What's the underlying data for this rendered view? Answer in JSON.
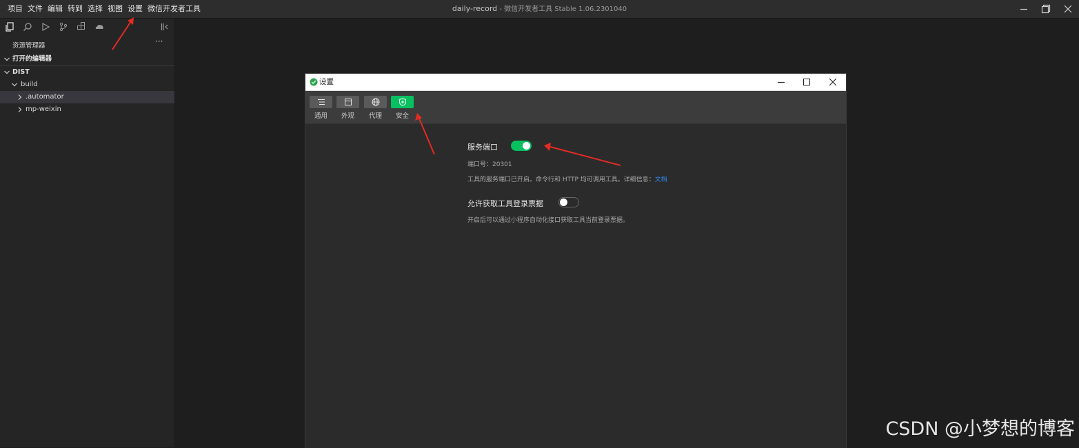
{
  "menu": {
    "items": [
      "项目",
      "文件",
      "编辑",
      "转到",
      "选择",
      "视图",
      "设置",
      "微信开发者工具"
    ]
  },
  "window": {
    "project": "daily-record",
    "separator": " - ",
    "app_name": "微信开发者工具 Stable 1.06.2301040"
  },
  "sidebar": {
    "toolbar_icons": [
      "files-icon",
      "search-icon",
      "debug-icon",
      "source-control-icon",
      "extensions-icon",
      "cloud-icon"
    ],
    "explorer_title": "资源管理器",
    "more": "···",
    "open_editors": "打开的编辑器",
    "tree": {
      "root": "DIST",
      "build": "build",
      "automator": ".automator",
      "mp_weixin": "mp-weixin"
    }
  },
  "dialog": {
    "title": "设置",
    "tabs": [
      {
        "label": "通用",
        "icon": "list-icon",
        "active": false
      },
      {
        "label": "外观",
        "icon": "window-icon",
        "active": false
      },
      {
        "label": "代理",
        "icon": "globe-icon",
        "active": false
      },
      {
        "label": "安全",
        "icon": "shield-icon",
        "active": true
      }
    ],
    "service_port": {
      "title": "服务端口",
      "enabled": true,
      "port_line": "端口号：20301",
      "desc": "工具的服务端口已开启。命令行和 HTTP 均可调用工具。详细信息：",
      "link": "文档"
    },
    "login_ticket": {
      "title": "允许获取工具登录票据",
      "enabled": false,
      "desc": "开启后可以通过小程序自动化接口获取工具当前登录票据。"
    }
  },
  "colors": {
    "accent_green": "#07c160",
    "annotation_red": "#e52b22",
    "link_blue": "#2f8cf0"
  },
  "watermark": "CSDN @小梦想的博客"
}
